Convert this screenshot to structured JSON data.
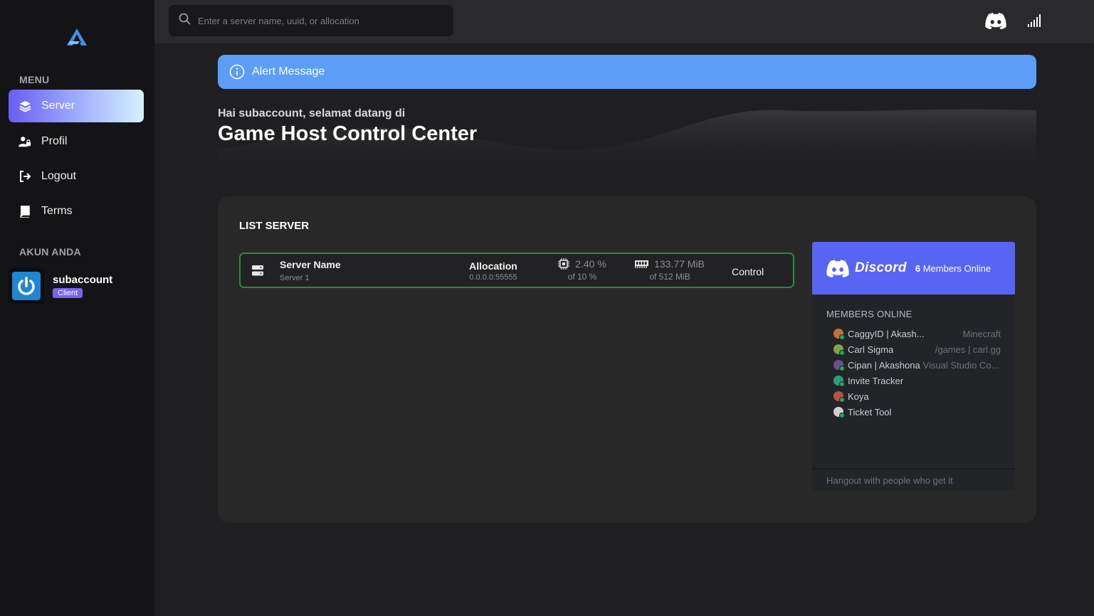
{
  "search": {
    "placeholder": "Enter a server name, uuid, or allocation"
  },
  "topbar": {
    "icons": [
      "discord-icon",
      "signal-icon"
    ]
  },
  "sidebar": {
    "menu_heading": "MENU",
    "items": [
      {
        "label": "Server",
        "icon": "layers-icon",
        "active": true
      },
      {
        "label": "Profil",
        "icon": "user-lock-icon",
        "active": false
      },
      {
        "label": "Logout",
        "icon": "logout-icon",
        "active": false
      },
      {
        "label": "Terms",
        "icon": "book-icon",
        "active": false
      }
    ],
    "account_heading": "AKUN ANDA",
    "account": {
      "name": "subaccount",
      "role": "Client"
    }
  },
  "alert": {
    "message": "Alert Message"
  },
  "hero": {
    "greeting": "Hai subaccount, selamat datang di",
    "title": "Game Host Control Center"
  },
  "panel": {
    "title": "LIST SERVER",
    "server": {
      "name_label": "Server Name",
      "name": "Server 1",
      "allocation_label": "Allocation",
      "allocation": "0.0.0.0:55555",
      "cpu_value": "2.40 %",
      "cpu_limit": "of 10 %",
      "mem_value": "133.77 MiB",
      "mem_limit": "of 512 MiB",
      "control_label": "Control",
      "border_color": "#2b8a3e"
    }
  },
  "discord": {
    "brand": "Discord",
    "online_count": "6",
    "online_label": "Members Online",
    "members_heading": "MEMBERS ONLINE",
    "members": [
      {
        "name": "CaggyID | Akash...",
        "activity": "Minecraft",
        "color": "#c0703a"
      },
      {
        "name": "Carl Sigma",
        "activity": "/games | carl.gg",
        "color": "#7aa83f"
      },
      {
        "name": "Cipan | Akashona",
        "activity": "Visual Studio Co...",
        "color": "#6a4f8a"
      },
      {
        "name": "Invite Tracker",
        "activity": "",
        "color": "#2e9c7a"
      },
      {
        "name": "Koya",
        "activity": "",
        "color": "#b8553a"
      },
      {
        "name": "Ticket Tool",
        "activity": "",
        "color": "#cfcfcf"
      }
    ],
    "footer": "Hangout with people who get it"
  },
  "colors": {
    "accent": "#5b9df7",
    "discord": "#5865f2",
    "online": "#23a55a"
  }
}
